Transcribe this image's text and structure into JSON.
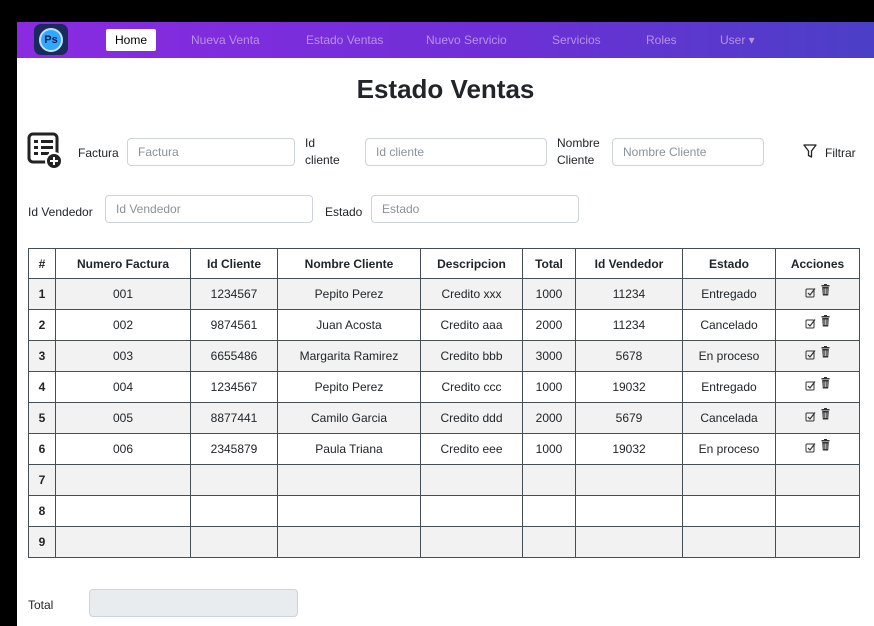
{
  "nav": {
    "brand_text": "Ps",
    "items": [
      {
        "label": "Home",
        "active": true
      },
      {
        "label": "Nueva Venta"
      },
      {
        "label": "Estado Ventas"
      },
      {
        "label": "Nuevo Servicio"
      },
      {
        "label": "Servicios"
      },
      {
        "label": "Roles"
      },
      {
        "label": "User ▾"
      }
    ]
  },
  "page": {
    "title": "Estado Ventas"
  },
  "filters": {
    "factura": {
      "label": "Factura",
      "placeholder": "Factura"
    },
    "id_cliente": {
      "label_line1": "Id",
      "label_line2": "cliente",
      "placeholder": "Id cliente"
    },
    "nombre_cliente": {
      "label_line1": "Nombre",
      "label_line2": "Cliente",
      "placeholder": "Nombre Cliente"
    },
    "filtrar_label": "Filtrar",
    "id_vendedor": {
      "label": "Id Vendedor",
      "placeholder": "Id Vendedor"
    },
    "estado": {
      "label": "Estado",
      "placeholder": "Estado"
    }
  },
  "table": {
    "headers": [
      "#",
      "Numero Factura",
      "Id Cliente",
      "Nombre Cliente",
      "Descripcion",
      "Total",
      "Id Vendedor",
      "Estado",
      "Acciones"
    ],
    "rows": [
      {
        "n": "1",
        "factura": "001",
        "id_cliente": "1234567",
        "nombre": "Pepito Perez",
        "descripcion": "Credito xxx",
        "total": "1000",
        "vendedor": "11234",
        "estado": "Entregado"
      },
      {
        "n": "2",
        "factura": "002",
        "id_cliente": "9874561",
        "nombre": "Juan Acosta",
        "descripcion": "Credito aaa",
        "total": "2000",
        "vendedor": "11234",
        "estado": "Cancelado"
      },
      {
        "n": "3",
        "factura": "003",
        "id_cliente": "6655486",
        "nombre": "Margarita Ramirez",
        "descripcion": "Credito bbb",
        "total": "3000",
        "vendedor": "5678",
        "estado": "En proceso"
      },
      {
        "n": "4",
        "factura": "004",
        "id_cliente": "1234567",
        "nombre": "Pepito Perez",
        "descripcion": "Credito ccc",
        "total": "1000",
        "vendedor": "19032",
        "estado": "Entregado"
      },
      {
        "n": "5",
        "factura": "005",
        "id_cliente": "8877441",
        "nombre": "Camilo Garcia",
        "descripcion": "Credito ddd",
        "total": "2000",
        "vendedor": "5679",
        "estado": "Cancelada"
      },
      {
        "n": "6",
        "factura": "006",
        "id_cliente": "2345879",
        "nombre": "Paula Triana",
        "descripcion": "Credito eee",
        "total": "1000",
        "vendedor": "19032",
        "estado": "En proceso"
      },
      {
        "n": "7"
      },
      {
        "n": "8"
      },
      {
        "n": "9"
      }
    ]
  },
  "footer": {
    "total_label": "Total",
    "total_value": ""
  },
  "colors": {
    "nav_start": "#8a2be2",
    "nav_end": "#4b3fc7",
    "nav_text": "#b98fe9",
    "table_stripe": "#f2f2f2"
  },
  "icons": {
    "form": "form-list-add-icon",
    "filter": "filter-funnel-icon",
    "edit": "check-square-icon",
    "delete": "trash-icon"
  }
}
